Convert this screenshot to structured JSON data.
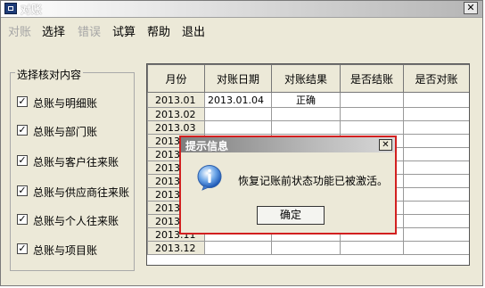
{
  "window": {
    "title": "对账",
    "close_glyph": "✕"
  },
  "menu": [
    {
      "label": "对账",
      "enabled": false
    },
    {
      "label": "选择",
      "enabled": true
    },
    {
      "label": "错误",
      "enabled": false
    },
    {
      "label": "试算",
      "enabled": true
    },
    {
      "label": "帮助",
      "enabled": true
    },
    {
      "label": "退出",
      "enabled": true
    }
  ],
  "checklist": {
    "legend": "选择核对内容",
    "items": [
      {
        "label": "总账与明细账",
        "checked": true
      },
      {
        "label": "总账与部门账",
        "checked": true
      },
      {
        "label": "总账与客户往来账",
        "checked": true
      },
      {
        "label": "总账与供应商往来账",
        "checked": true
      },
      {
        "label": "总账与个人往来账",
        "checked": true
      },
      {
        "label": "总账与项目账",
        "checked": true
      }
    ]
  },
  "grid": {
    "columns": [
      "月份",
      "对账日期",
      "对账结果",
      "是否结账",
      "是否对账"
    ],
    "rows": [
      [
        "2013.01",
        "2013.01.04",
        "正确",
        "",
        ""
      ],
      [
        "2013.02",
        "",
        "",
        "",
        ""
      ],
      [
        "2013.03",
        "",
        "",
        "",
        ""
      ],
      [
        "2013.04",
        "",
        "",
        "",
        ""
      ],
      [
        "2013.05",
        "",
        "",
        "",
        ""
      ],
      [
        "2013.06",
        "",
        "",
        "",
        ""
      ],
      [
        "2013.07",
        "",
        "",
        "",
        ""
      ],
      [
        "2013.08",
        "",
        "",
        "",
        ""
      ],
      [
        "2013.09",
        "",
        "",
        "",
        ""
      ],
      [
        "2013.10",
        "",
        "",
        "",
        ""
      ],
      [
        "2013.11",
        "",
        "",
        "",
        ""
      ],
      [
        "2013.12",
        "",
        "",
        "",
        ""
      ]
    ]
  },
  "dialog": {
    "title": "提示信息",
    "close_glyph": "✕",
    "icon": "info-icon",
    "message": "恢复记账前状态功能已被激活。",
    "ok_label": "确定"
  },
  "colors": {
    "dialog_border": "#d21f1f",
    "face": "#ece9d8"
  }
}
